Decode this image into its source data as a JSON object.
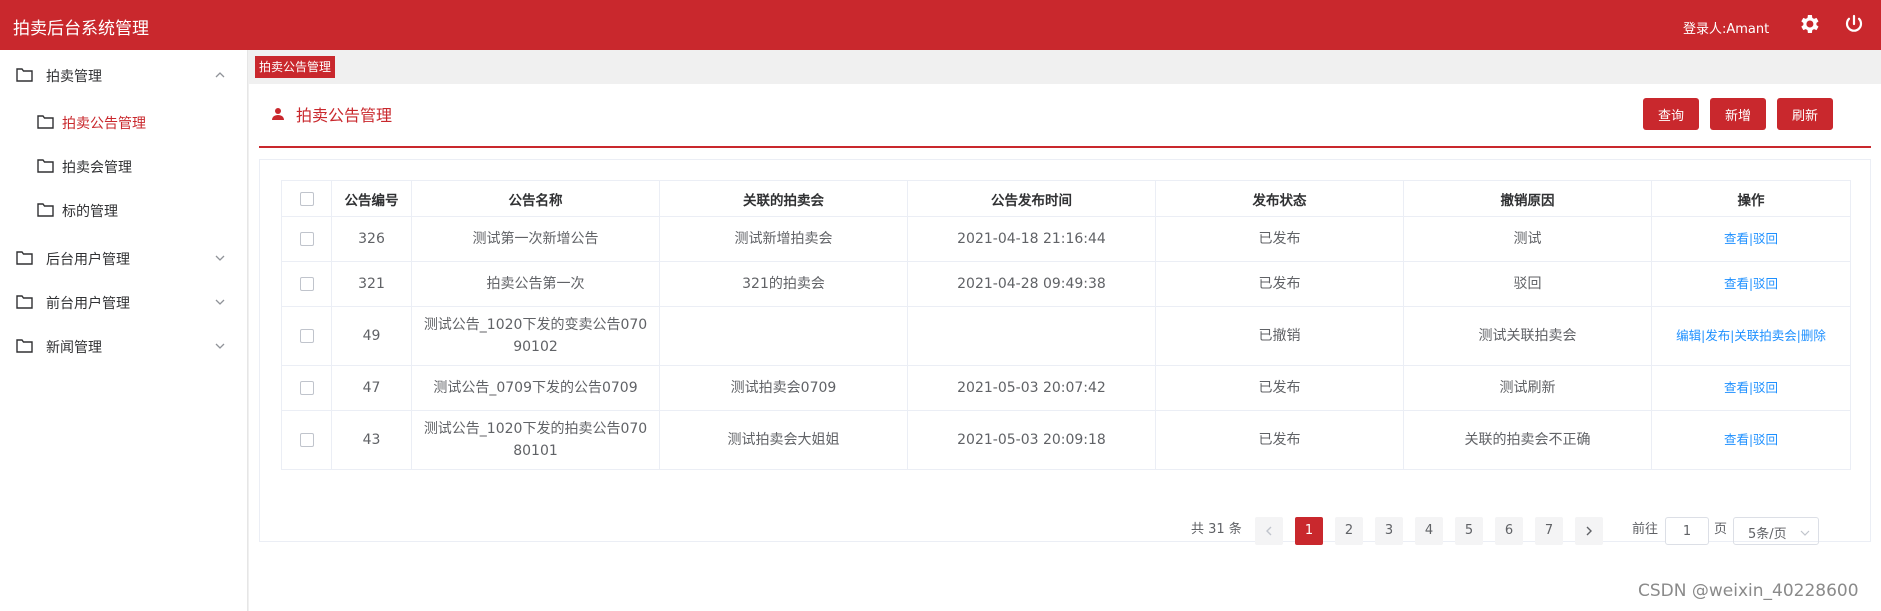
{
  "app": {
    "title": "拍卖后台系统管理",
    "login_user": "登录人:Amant"
  },
  "sidebar": {
    "items": [
      {
        "label": "拍卖管理"
      },
      {
        "label": "拍卖公告管理"
      },
      {
        "label": "拍卖会管理"
      },
      {
        "label": "标的管理"
      },
      {
        "label": "后台用户管理"
      },
      {
        "label": "前台用户管理"
      },
      {
        "label": "新闻管理"
      }
    ]
  },
  "tab": {
    "label": "拍卖公告管理"
  },
  "page": {
    "title": "拍卖公告管理"
  },
  "toolbar": {
    "query": "查询",
    "add": "新增",
    "refresh": "刷新"
  },
  "table": {
    "headers": [
      "公告编号",
      "公告名称",
      "关联的拍卖会",
      "公告发布时间",
      "发布状态",
      "撤销原因",
      "操作"
    ],
    "rows": [
      {
        "id": "326",
        "name": "测试第一次新增公告",
        "auction": "测试新增拍卖会",
        "time": "2021-04-18 21:16:44",
        "status": "已发布",
        "reason": "测试",
        "ops": [
          "查看",
          "驳回"
        ]
      },
      {
        "id": "321",
        "name": "拍卖公告第一次",
        "auction": "321的拍卖会",
        "time": "2021-04-28 09:49:38",
        "status": "已发布",
        "reason": "驳回",
        "ops": [
          "查看",
          "驳回"
        ]
      },
      {
        "id": "49",
        "name": "测试公告_1020下发的变卖公告07090102",
        "auction": "",
        "time": "",
        "status": "已撤销",
        "reason": "测试关联拍卖会",
        "ops": [
          "编辑",
          "发布",
          "关联拍卖会",
          "删除"
        ]
      },
      {
        "id": "47",
        "name": "测试公告_0709下发的公告0709",
        "auction": "测试拍卖会0709",
        "time": "2021-05-03 20:07:42",
        "status": "已发布",
        "reason": "测试刷新",
        "ops": [
          "查看",
          "驳回"
        ]
      },
      {
        "id": "43",
        "name": "测试公告_1020下发的拍卖公告07080101",
        "auction": "测试拍卖会大姐姐",
        "time": "2021-05-03 20:09:18",
        "status": "已发布",
        "reason": "关联的拍卖会不正确",
        "ops": [
          "查看",
          "驳回"
        ]
      }
    ]
  },
  "pagination": {
    "total": "共 31 条",
    "pages": [
      "1",
      "2",
      "3",
      "4",
      "5",
      "6",
      "7"
    ],
    "current": "1",
    "goto_label": "前往",
    "goto_value": "1",
    "page_suffix": "页",
    "page_size": "5条/页"
  },
  "watermark": "CSDN @weixin_40228600",
  "colors": {
    "brand": "#c9282d",
    "link": "#1e90ff"
  }
}
